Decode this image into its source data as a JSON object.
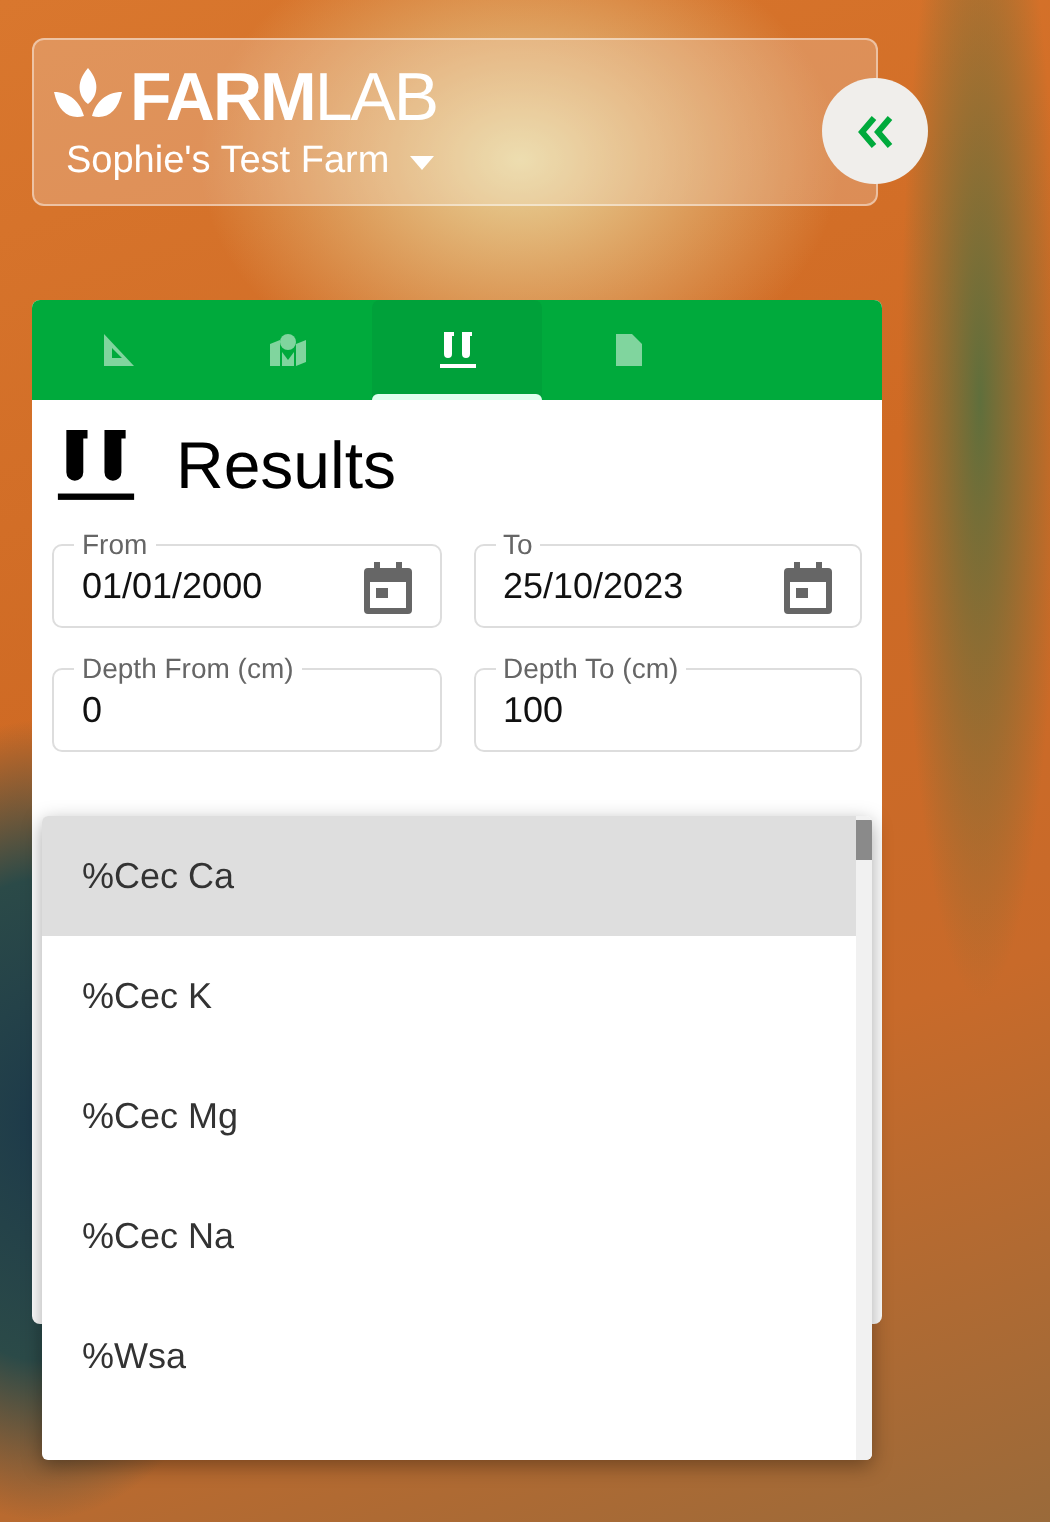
{
  "header": {
    "logo": "**FARM**LAB",
    "farm_name": "Sophie's Test Farm"
  },
  "tabs": [
    {
      "selected": false
    },
    {
      "selected": false
    },
    {
      "selected": true
    },
    {
      "selected": false
    }
  ],
  "panel": {
    "title": "Results",
    "fields": [
      {
        "kind": "date",
        "label": "From",
        "value": "01/01/2000"
      },
      {
        "kind": "date",
        "label": "To",
        "value": "25/10/2023"
      },
      {
        "kind": "number",
        "label": "Depth From (cm)",
        "value": "0"
      },
      {
        "kind": "number",
        "label": "Depth To (cm)",
        "value": "100"
      }
    ]
  },
  "dropdown": {
    "options": [
      {
        "label": "%Cec Ca",
        "selected": true
      },
      {
        "label": "%Cec K",
        "selected": false
      },
      {
        "label": "%Cec Mg",
        "selected": false
      },
      {
        "label": "%Cec Na",
        "selected": false
      },
      {
        "label": "%Wsa",
        "selected": false
      }
    ]
  }
}
